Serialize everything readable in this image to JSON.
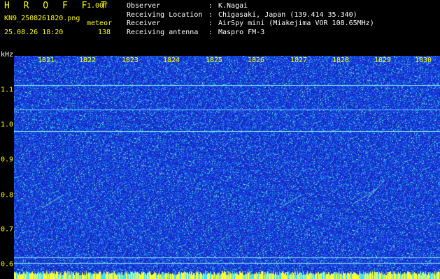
{
  "header": {
    "app_title": "H R O F F T",
    "version": "1.00f",
    "filename": "KN9_2508261820.png",
    "datetime": "25.08.26 18:20",
    "mode": "meteor",
    "count": "138"
  },
  "info": {
    "observer_label": "Observer",
    "observer_value": "K.Nagai",
    "location_label": "Receiving Location",
    "location_value": "Chigasaki, Japan (139.414 35.340)",
    "receiver_label": "Receiver",
    "receiver_value": "AirSpy mini (Miakejima VOR 108.65MHz)",
    "antenna_label": "Receiving antenna",
    "antenna_value": "Maspro FM-3",
    "separator": ":"
  },
  "axes": {
    "y_unit": "kHz",
    "x_ticks": [
      "1821",
      "1822",
      "1823",
      "1824",
      "1825",
      "1826",
      "1827",
      "1828",
      "1829",
      "1830"
    ],
    "y_ticks": [
      "1.1",
      "1.0",
      "0.9",
      "0.8",
      "0.7",
      "0.6"
    ]
  },
  "colors": {
    "background": "#000000",
    "label_yellow": "#ffff00",
    "spectrogram_base": "#1a2ccf",
    "signal_cyan": "#00ffff",
    "hline_lines": "#8fe8ff"
  }
}
